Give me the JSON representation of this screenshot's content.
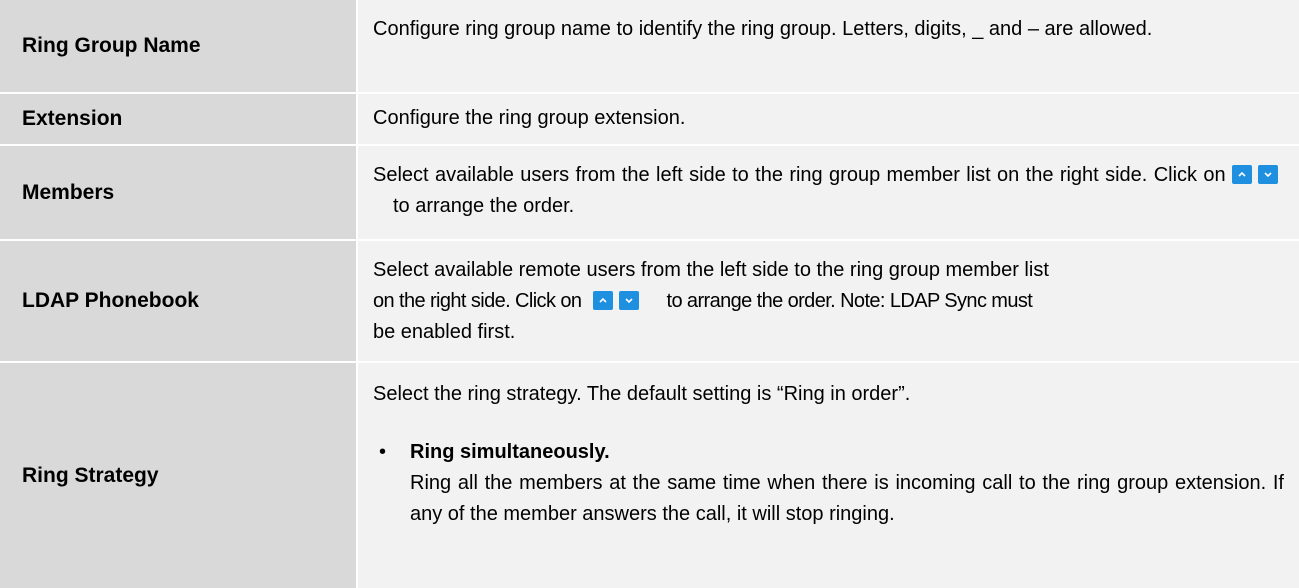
{
  "rows": [
    {
      "label": "Ring Group Name",
      "description": "Configure ring group name to identify the ring group. Letters, digits, _ and – are allowed."
    },
    {
      "label": "Extension",
      "description": "Configure the ring group extension."
    },
    {
      "label": "Members",
      "description_before": "Select available users from the left side to the ring group member list on the right side. Click on",
      "description_after": "to arrange the order."
    },
    {
      "label": "LDAP Phonebook",
      "description_line1": "Select available remote users from the left side to the ring group member list",
      "description_before": "on the right side. Click on",
      "description_after": "to arrange the order. Note: LDAP Sync must",
      "description_line3": "be enabled first."
    },
    {
      "label": "Ring Strategy",
      "intro": "Select the ring strategy. The default setting is “Ring in order”.",
      "bullet_title": "Ring simultaneously.",
      "bullet_text": "Ring all the members at the same time when there is incoming call to the ring group extension. If any of the member answers the call, it will stop ringing."
    }
  ],
  "icons": {
    "up": "chevron-up-icon",
    "down": "chevron-down-icon",
    "button_color": "#1f8fe0"
  }
}
